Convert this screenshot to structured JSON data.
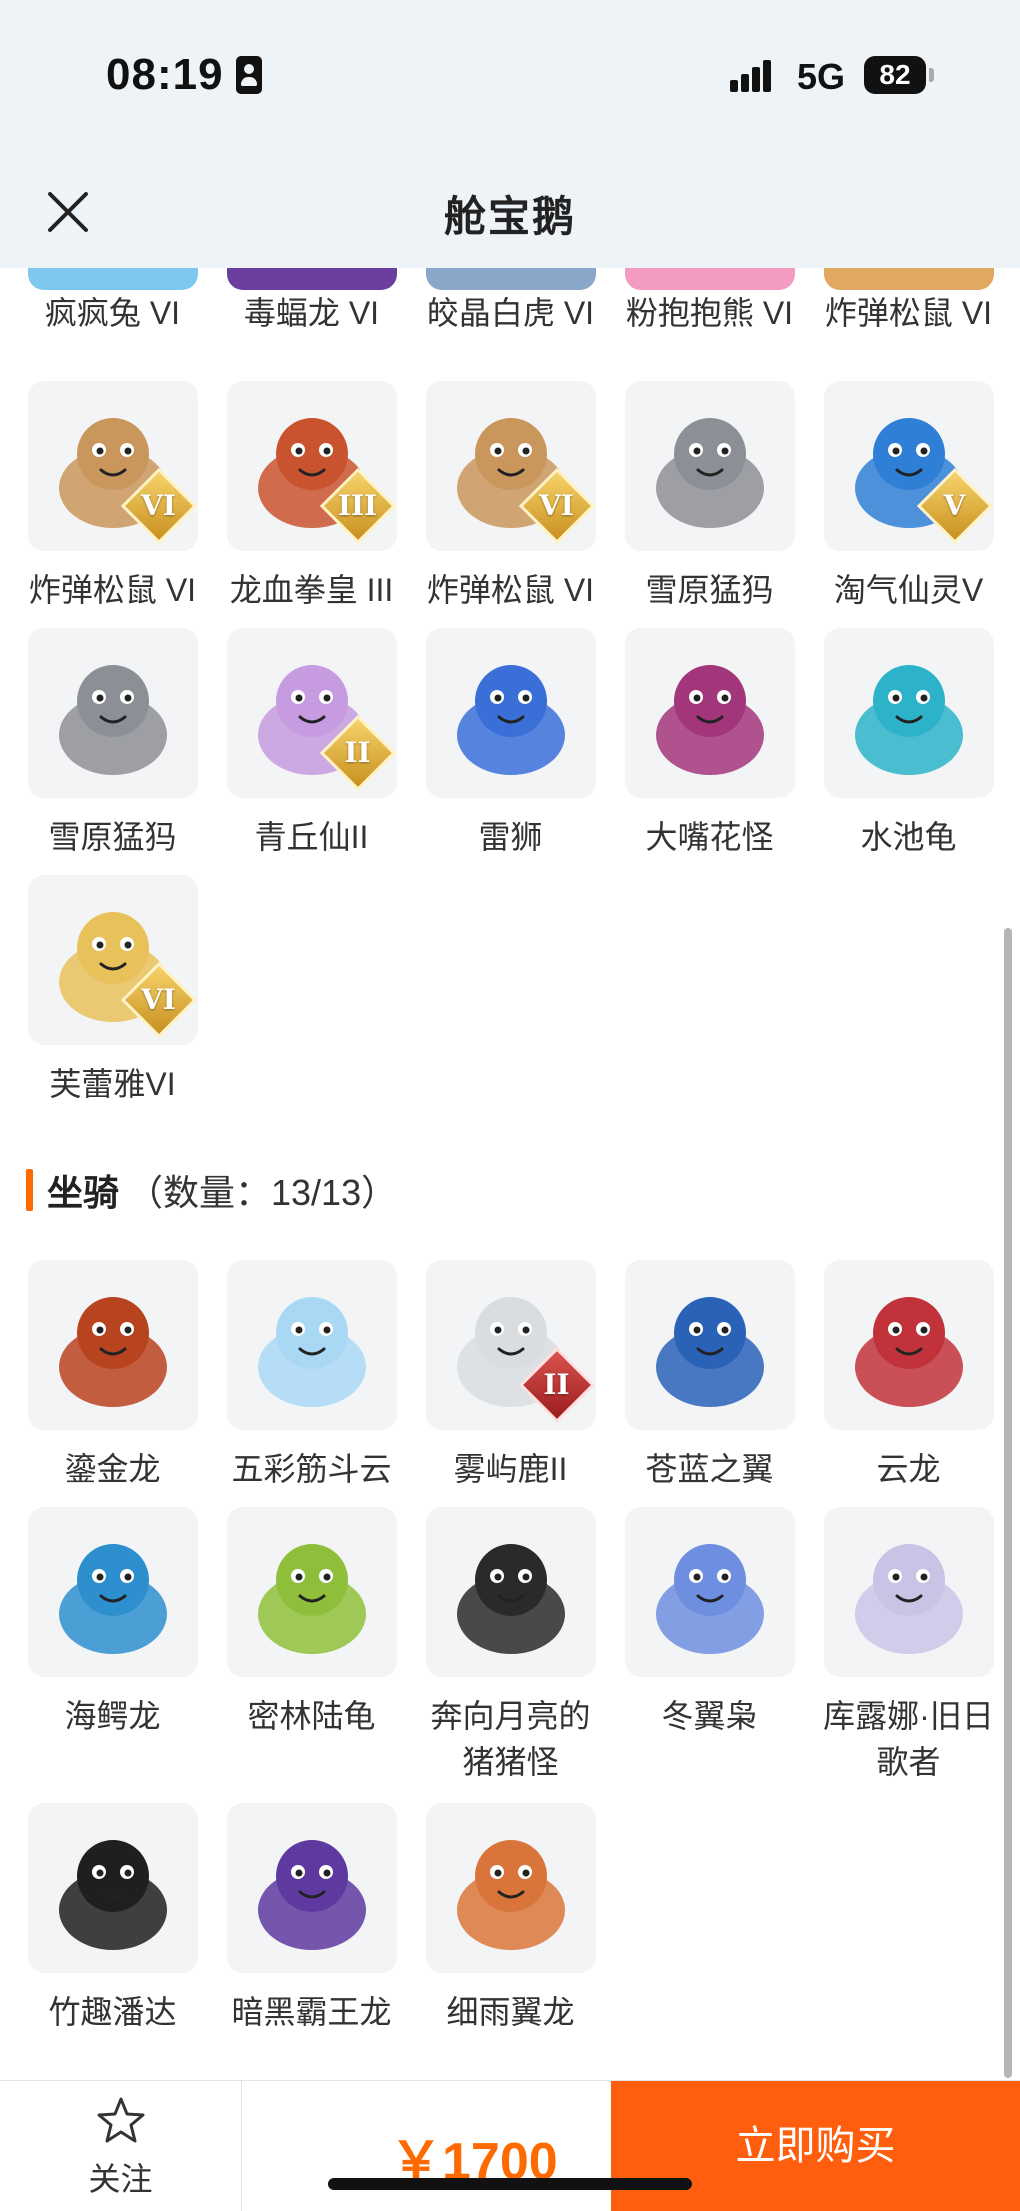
{
  "status_bar": {
    "time": "08:19",
    "network": "5G",
    "battery": "82"
  },
  "header": {
    "title": "舱宝鹅"
  },
  "pets_cut_row": [
    {
      "name": "疯疯兔 VI",
      "color": "#7ec8f0"
    },
    {
      "name": "毒蝠龙 VI",
      "color": "#6b3fa0"
    },
    {
      "name": "皎晶白虎 VI",
      "color": "#8aa6c8"
    },
    {
      "name": "粉抱抱熊 VI",
      "color": "#f39bc0"
    },
    {
      "name": "炸弹松鼠 VI",
      "color": "#e0a860"
    }
  ],
  "pets": [
    {
      "name": "炸弹松鼠 VI",
      "badge": "VI",
      "icon": "squirrel-icon",
      "color": "#c9965c"
    },
    {
      "name": "龙血拳皇 III",
      "badge": "III",
      "icon": "dragon-boxer-icon",
      "color": "#c9532f"
    },
    {
      "name": "炸弹松鼠 VI",
      "badge": "VI",
      "icon": "squirrel-icon",
      "color": "#c9965c"
    },
    {
      "name": "雪原猛犸",
      "badge": "",
      "icon": "mammoth-icon",
      "color": "#8d8f96"
    },
    {
      "name": "淘气仙灵V",
      "badge": "V",
      "icon": "fairy-pup-icon",
      "color": "#2f7fd6"
    },
    {
      "name": "雪原猛犸",
      "badge": "",
      "icon": "mammoth-icon",
      "color": "#8d8f96"
    },
    {
      "name": "青丘仙II",
      "badge": "II",
      "icon": "fox-fairy-icon",
      "color": "#c69be0"
    },
    {
      "name": "雷狮",
      "badge": "",
      "icon": "thunder-lion-icon",
      "color": "#3a6fd8"
    },
    {
      "name": "大嘴花怪",
      "badge": "",
      "icon": "piranha-plant-icon",
      "color": "#a3357a"
    },
    {
      "name": "水池龟",
      "badge": "",
      "icon": "pool-turtle-icon",
      "color": "#2cb3c9"
    },
    {
      "name": "芙蕾雅VI",
      "badge": "VI",
      "icon": "freya-icon",
      "color": "#e8c15a"
    }
  ],
  "mounts_section": {
    "title": "坐骑",
    "count": "（数量：13/13）"
  },
  "mounts": [
    {
      "name": "鎏金龙",
      "badge": "",
      "icon": "gold-dragon-icon",
      "color": "#b8431f"
    },
    {
      "name": "五彩筋斗云",
      "badge": "",
      "icon": "cloud-icon",
      "color": "#a9d8f5"
    },
    {
      "name": "雾屿鹿II",
      "badge": "II",
      "icon": "deer-icon",
      "color": "#d9dde0"
    },
    {
      "name": "苍蓝之翼",
      "badge": "",
      "icon": "blue-eagle-icon",
      "color": "#2a62b8"
    },
    {
      "name": "云龙",
      "badge": "",
      "icon": "cloud-dragon-icon",
      "color": "#c1323b"
    },
    {
      "name": "海鳄龙",
      "badge": "",
      "icon": "sea-dragon-icon",
      "color": "#2d8fce"
    },
    {
      "name": "密林陆龟",
      "badge": "",
      "icon": "forest-tortoise-icon",
      "color": "#8fbf3a"
    },
    {
      "name": "奔向月亮的猪猪怪",
      "badge": "",
      "icon": "moon-pig-icon",
      "color": "#2a2a2a"
    },
    {
      "name": "冬翼枭",
      "badge": "",
      "icon": "winter-owl-icon",
      "color": "#6e8fe0"
    },
    {
      "name": "库露娜·旧日歌者",
      "badge": "",
      "icon": "singer-icon",
      "color": "#c9c4e6"
    },
    {
      "name": "竹趣潘达",
      "badge": "",
      "icon": "panda-icon",
      "color": "#1f1f1f"
    },
    {
      "name": "暗黑霸王龙",
      "badge": "",
      "icon": "dark-trex-icon",
      "color": "#5e3aa0"
    },
    {
      "name": "细雨翼龙",
      "badge": "",
      "icon": "rain-pterosaur-icon",
      "color": "#d9753a"
    }
  ],
  "bottom_bar": {
    "follow_label": "关注",
    "price": "￥1700",
    "buy_label": "立即购买"
  },
  "colors": {
    "accent": "#ff5e0e",
    "price": "#ff6a00"
  }
}
